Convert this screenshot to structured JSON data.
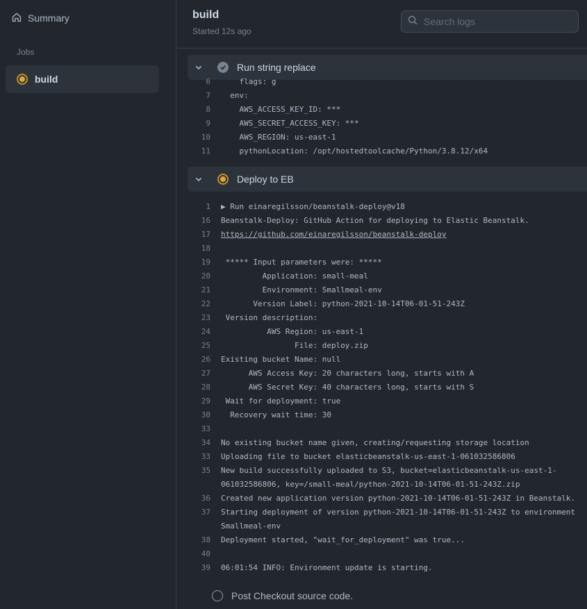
{
  "sidebar": {
    "summary_label": "Summary",
    "jobs_heading": "Jobs",
    "jobs": [
      {
        "label": "build",
        "status": "in-progress"
      }
    ]
  },
  "header": {
    "title": "build",
    "subtitle": "Started 12s ago",
    "search_placeholder": "Search logs"
  },
  "steps": [
    {
      "name": "Run string replace",
      "status": "completed",
      "lines": [
        {
          "n": "6",
          "t": "    flags: g"
        },
        {
          "n": "7",
          "t": "  env:"
        },
        {
          "n": "8",
          "t": "    AWS_ACCESS_KEY_ID: ***"
        },
        {
          "n": "9",
          "t": "    AWS_SECRET_ACCESS_KEY: ***"
        },
        {
          "n": "10",
          "t": "    AWS_REGION: us-east-1"
        },
        {
          "n": "11",
          "t": "    pythonLocation: /opt/hostedtoolcache/Python/3.8.12/x64"
        }
      ]
    },
    {
      "name": "Deploy to EB",
      "status": "in-progress",
      "lines": [
        {
          "n": "1",
          "t": "▶ Run einaregilsson/beanstalk-deploy@v18"
        },
        {
          "n": "16",
          "t": "Beanstalk-Deploy: GitHub Action for deploying to Elastic Beanstalk."
        },
        {
          "n": "17",
          "t": "https://github.com/einaregilsson/beanstalk-deploy"
        },
        {
          "n": "18",
          "t": ""
        },
        {
          "n": "19",
          "t": " ***** Input parameters were: *****"
        },
        {
          "n": "20",
          "t": "         Application: small-meal"
        },
        {
          "n": "21",
          "t": "         Environment: Smallmeal-env"
        },
        {
          "n": "22",
          "t": "       Version Label: python-2021-10-14T06-01-51-243Z"
        },
        {
          "n": "23",
          "t": " Version description:"
        },
        {
          "n": "24",
          "t": "          AWS Region: us-east-1"
        },
        {
          "n": "25",
          "t": "                File: deploy.zip"
        },
        {
          "n": "26",
          "t": "Existing bucket Name: null"
        },
        {
          "n": "27",
          "t": "      AWS Access Key: 20 characters long, starts with A"
        },
        {
          "n": "28",
          "t": "      AWS Secret Key: 40 characters long, starts with S"
        },
        {
          "n": "29",
          "t": " Wait for deployment: true"
        },
        {
          "n": "30",
          "t": "  Recovery wait time: 30"
        },
        {
          "n": "33",
          "t": ""
        },
        {
          "n": "34",
          "t": "No existing bucket name given, creating/requesting storage location"
        },
        {
          "n": "33",
          "t": "Uploading file to bucket elasticbeanstalk-us-east-1-061032586806"
        },
        {
          "n": "35",
          "t": "New build successfully uploaded to S3, bucket=elasticbeanstalk-us-east-1-061032586806, key=/small-meal/python-2021-10-14T06-01-51-243Z.zip"
        },
        {
          "n": "36",
          "t": "Created new application version python-2021-10-14T06-01-51-243Z in Beanstalk."
        },
        {
          "n": "37",
          "t": "Starting deployment of version python-2021-10-14T06-01-51-243Z to environment Smallmeal-env"
        },
        {
          "n": "38",
          "t": "Deployment started, \"wait_for_deployment\" was true..."
        },
        {
          "n": "40",
          "t": ""
        },
        {
          "n": "39",
          "t": "06:01:54 INFO: Environment update is starting."
        }
      ]
    },
    {
      "name": "Post Checkout source code.",
      "status": "pending"
    }
  ]
}
